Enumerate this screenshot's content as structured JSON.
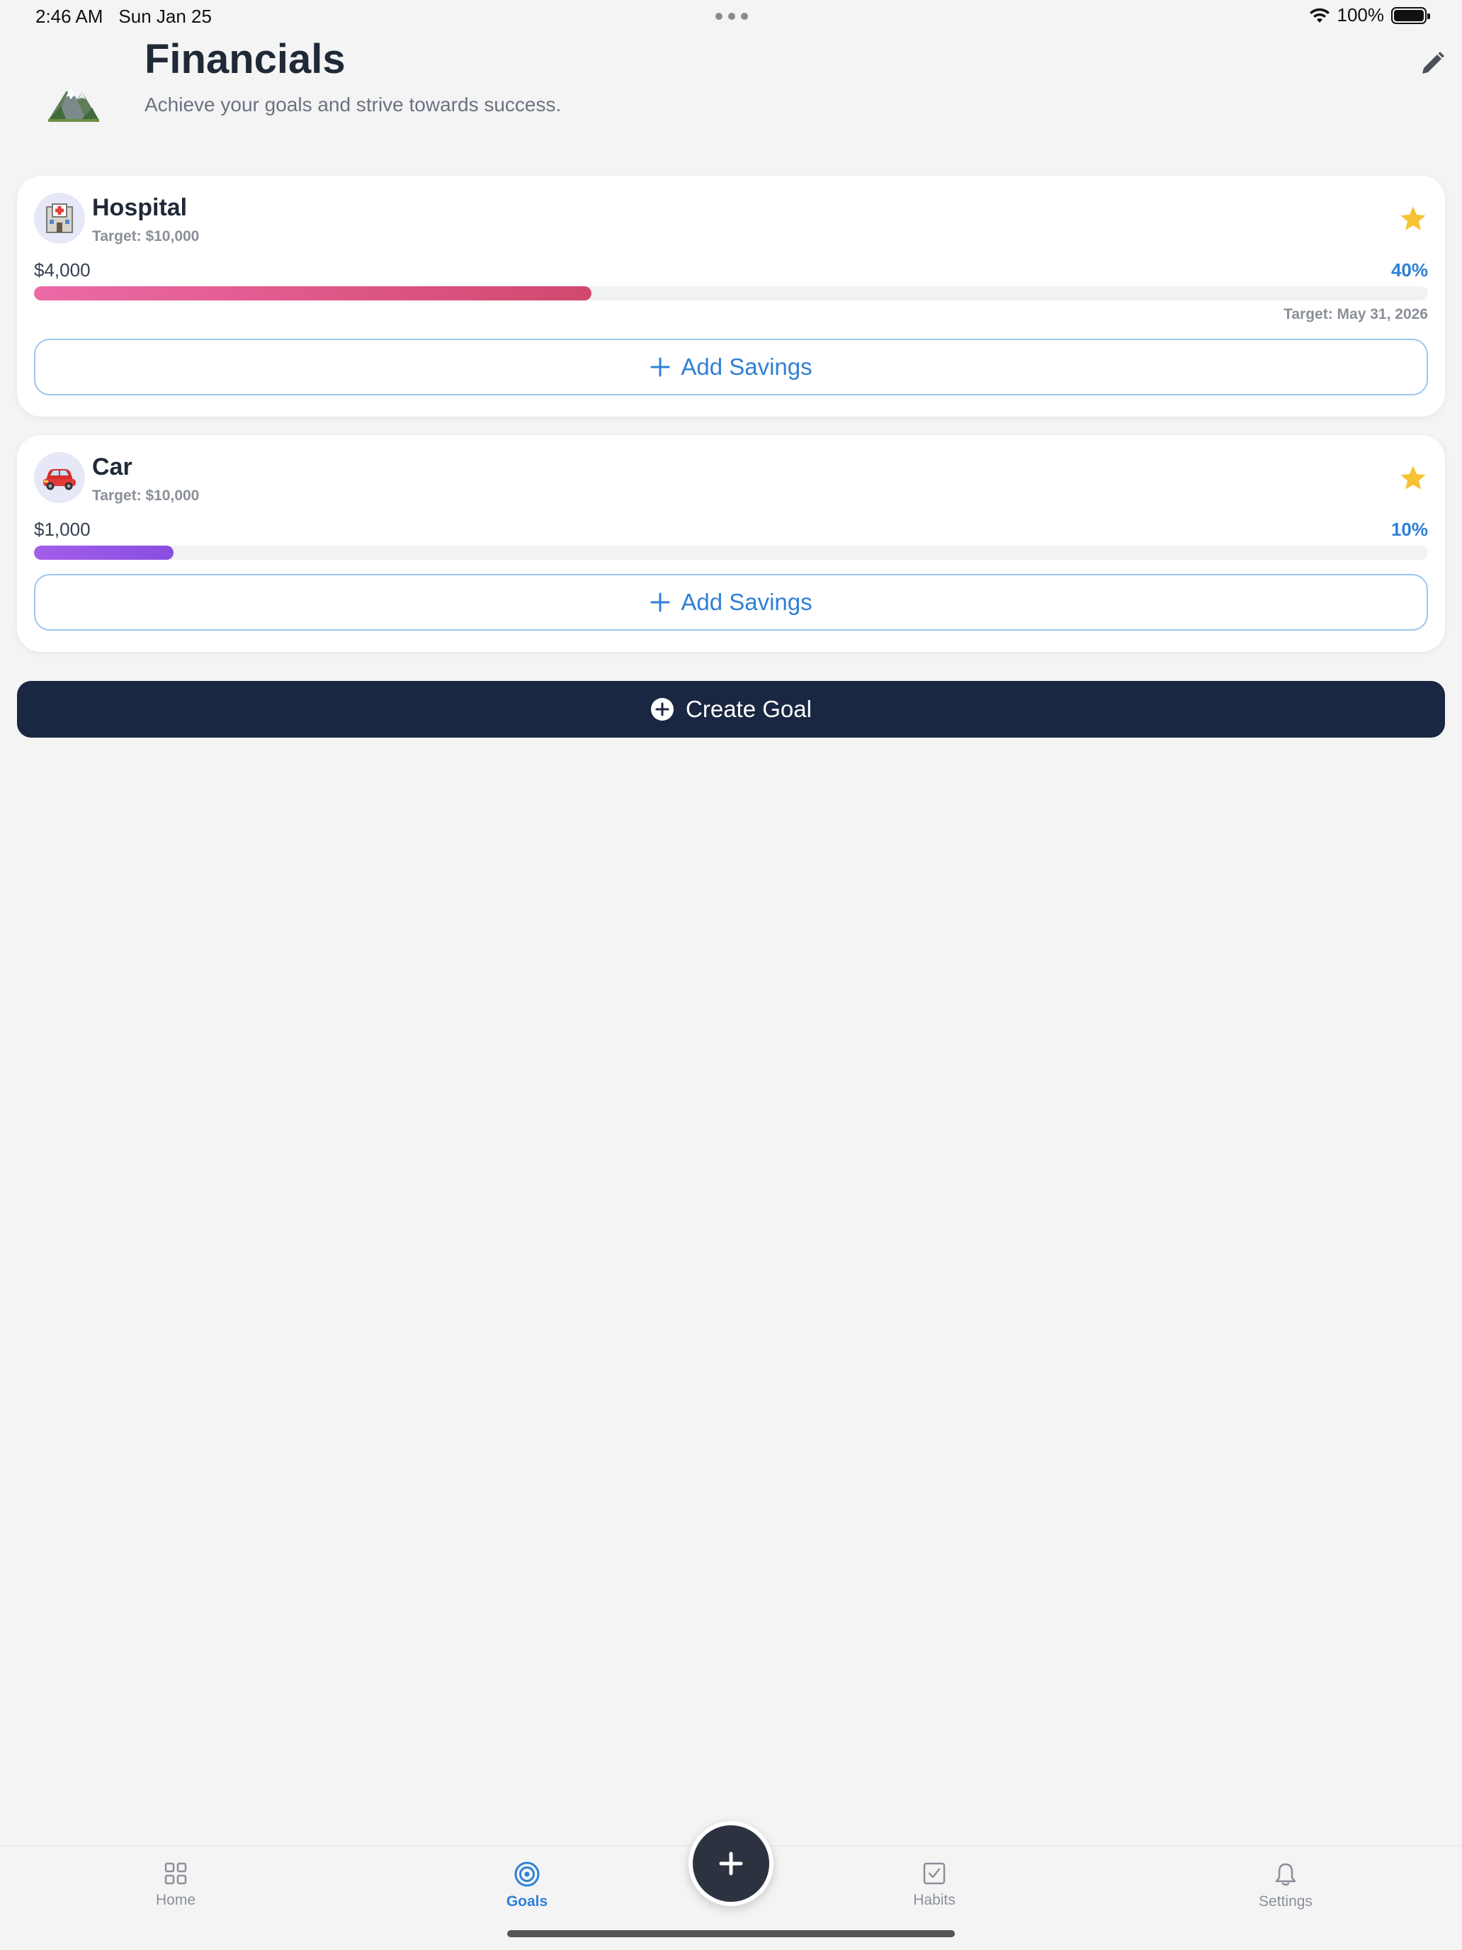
{
  "status_bar": {
    "time": "2:46 AM",
    "date": "Sun Jan 25",
    "battery": "100%"
  },
  "header": {
    "title": "Financials",
    "subtitle": "Achieve your goals and strive towards success.",
    "icon": "mountain-icon",
    "edit_icon": "pencil-icon"
  },
  "goals": [
    {
      "name": "Hospital",
      "icon": "hospital-icon",
      "target_label": "Target: $10,000",
      "saved": "$4,000",
      "percent_label": "40%",
      "progress": 0.4,
      "date_label": "Target: May 31, 2026",
      "favorite": true,
      "action_label": "Add Savings"
    },
    {
      "name": "Car",
      "icon": "car-icon",
      "target_label": "Target: $10,000",
      "saved": "$1,000",
      "percent_label": "10%",
      "progress": 0.1,
      "favorite": true,
      "action_label": "Add Savings"
    }
  ],
  "create_goal": {
    "label": "Create Goal"
  },
  "bottom_nav": {
    "items": [
      {
        "label": "Home",
        "icon": "grid-icon",
        "active": false
      },
      {
        "label": "Goals",
        "icon": "target-icon",
        "active": true
      },
      {
        "label": "Habits",
        "icon": "checkbox-icon",
        "active": false
      },
      {
        "label": "Settings",
        "icon": "bell-icon",
        "active": false
      }
    ],
    "fab_icon": "plus-icon"
  },
  "colors": {
    "accent": "#2f80d5",
    "primary_dark": "#1a2742",
    "star": "#f6c234",
    "hospital_progress": "#d2486e",
    "car_progress": "#8a4ee0"
  }
}
